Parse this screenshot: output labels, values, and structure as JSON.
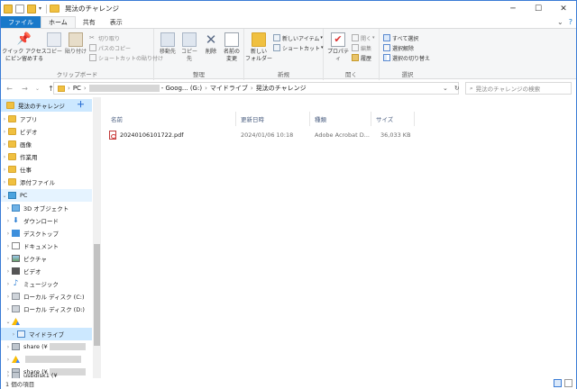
{
  "window": {
    "title": "晃汰のチャレンジ",
    "controls": {
      "minimize": "─",
      "maximize": "☐",
      "close": "✕"
    }
  },
  "ribbon_tabs": [
    {
      "label": "ファイル"
    },
    {
      "label": "ホーム"
    },
    {
      "label": "共有"
    },
    {
      "label": "表示"
    }
  ],
  "ribbon": {
    "clipboard": {
      "quick_access_pin": "クイック アクセス\nにピン留めする",
      "copy": "コピー",
      "paste": "貼り付け",
      "cut": "切り取り",
      "copy_path": "パスのコピー",
      "paste_shortcut": "ショートカットの貼り付け",
      "label": "クリップボード"
    },
    "organize": {
      "move_to": "移動先",
      "copy_to": "コピー先",
      "delete": "削除",
      "rename": "名前の\n変更",
      "label": "整理"
    },
    "new": {
      "new_folder": "新しい\nフォルダー",
      "new_item": "新しいアイテム",
      "shortcut": "ショートカット",
      "label": "新規"
    },
    "open": {
      "properties": "プロパティ",
      "open": "開く",
      "edit": "編集",
      "history": "履歴",
      "label": "開く"
    },
    "select": {
      "select_all": "すべて選択",
      "select_none": "選択解除",
      "invert": "選択の切り替え",
      "label": "選択"
    }
  },
  "address": {
    "pc": "PC",
    "drive": "- Goog... (G:)",
    "mydrive": "マイドライブ",
    "folder": "晃汰のチャレンジ",
    "search_placeholder": "晃汰のチャレンジの検索"
  },
  "nav": {
    "quick_access": "晃汰のチャレンジ",
    "items": [
      {
        "label": "アプリ",
        "icon": "folder-icon"
      },
      {
        "label": "ビデオ",
        "icon": "folder-icon"
      },
      {
        "label": "画像",
        "icon": "folder-icon"
      },
      {
        "label": "作業用",
        "icon": "folder-icon"
      },
      {
        "label": "仕事",
        "icon": "folder-icon"
      },
      {
        "label": "添付ファイル",
        "icon": "folder-icon"
      }
    ],
    "pc": "PC",
    "pc_items": [
      {
        "label": "3D オブジェクト"
      },
      {
        "label": "ダウンロード"
      },
      {
        "label": "デスクトップ"
      },
      {
        "label": "ドキュメント"
      },
      {
        "label": "ピクチャ"
      },
      {
        "label": "ビデオ"
      },
      {
        "label": "ミュージック"
      },
      {
        "label": "ローカル ディスク (C:)"
      },
      {
        "label": "ローカル ディスク (D:)"
      }
    ],
    "google_drive": "",
    "mydrive": "マイドライブ",
    "share1": "share (¥",
    "share2": "share (¥",
    "usb": "usbdisk1 (¥"
  },
  "columns": {
    "name": "名前",
    "modified": "更新日時",
    "type": "種類",
    "size": "サイズ"
  },
  "files": [
    {
      "name": "20240106101722.pdf",
      "modified": "2024/01/06 10:18",
      "type": "Adobe Acrobat D...",
      "size": "36,033 KB"
    }
  ],
  "status": {
    "count": "1 個の項目"
  },
  "colors": {
    "accent": "#1979ca",
    "selection": "#cce8ff",
    "folder": "#f0c040"
  }
}
